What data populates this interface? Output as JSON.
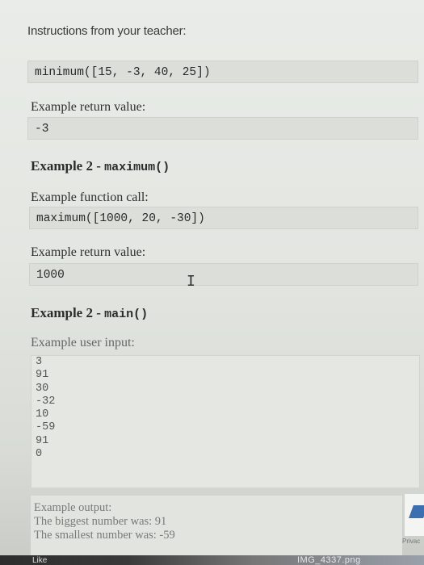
{
  "instructions_title": "Instructions from your teacher:",
  "example1": {
    "call": "minimum([15, -3, 40, 25])",
    "return_label": "Example return value:",
    "return_value": "-3"
  },
  "example2_maximum": {
    "heading_prefix": "Example 2 - ",
    "heading_code": "maximum()",
    "call_label": "Example function call:",
    "call": "maximum([1000, 20, -30])",
    "return_label": "Example return value:",
    "return_value": "1000"
  },
  "example2_main": {
    "heading_prefix": "Example 2 - ",
    "heading_code": "main()",
    "input_label": "Example user input:",
    "inputs": [
      "3",
      "91",
      "30",
      "-32",
      "10",
      "-59",
      "91",
      "0"
    ],
    "output_label": "Example output:",
    "output_lines": [
      "The biggest number was: 91",
      "The smallest number was: -59"
    ]
  },
  "footer": {
    "like": "Like",
    "privacy": "Privac",
    "filename": "IMG_4337.png"
  }
}
